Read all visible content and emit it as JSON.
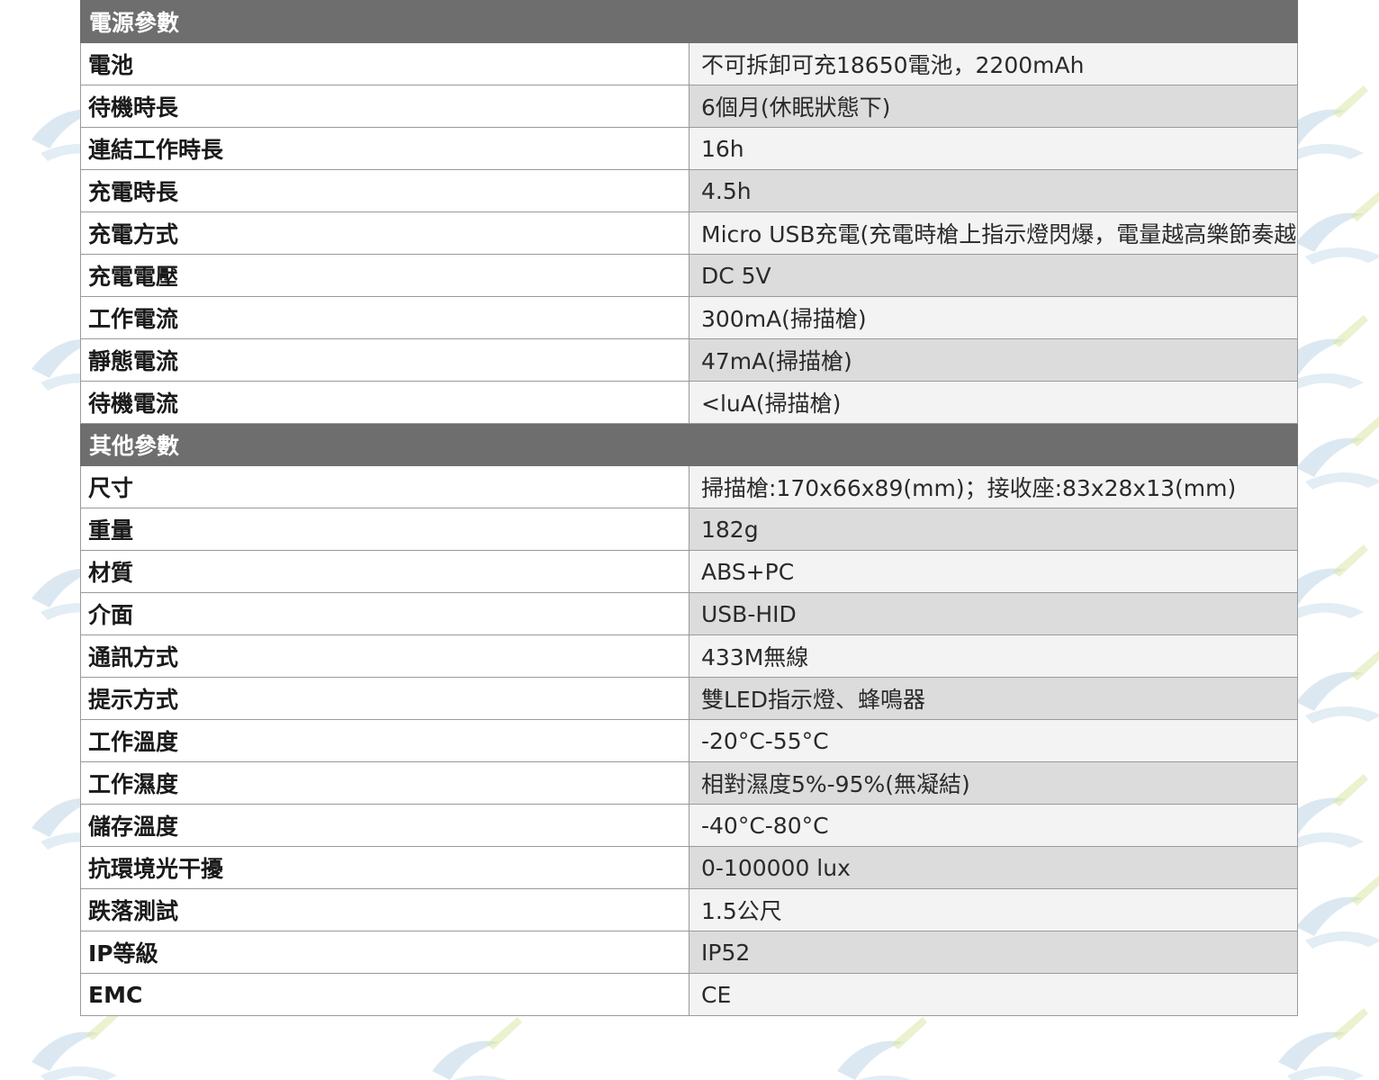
{
  "colors": {
    "header_bg": "#6e6e6e",
    "row_light": "#f3f3f3",
    "row_dark": "#dcdcdc",
    "watermark": "#cfe0ea"
  },
  "sections": [
    {
      "title": "電源參數",
      "rows": [
        {
          "label": "電池",
          "value": "不可拆卸可充18650電池，2200mAh"
        },
        {
          "label": "待機時長",
          "value": "6個月(休眠狀態下)"
        },
        {
          "label": "連結工作時長",
          "value": "16h"
        },
        {
          "label": "充電時長",
          "value": "4.5h"
        },
        {
          "label": "充電方式",
          "value": "Micro USB充電(充電時槍上指示燈閃爆，電量越高樂節奏越慢)"
        },
        {
          "label": "充電電壓",
          "value": "DC 5V"
        },
        {
          "label": "工作電流",
          "value": "300mA(掃描槍)"
        },
        {
          "label": "靜態電流",
          "value": "47mA(掃描槍)"
        },
        {
          "label": "待機電流",
          "value": "<luA(掃描槍)"
        }
      ]
    },
    {
      "title": "其他參數",
      "rows": [
        {
          "label": "尺寸",
          "value": "掃描槍:170x66x89(mm)；接收座:83x28x13(mm)"
        },
        {
          "label": "重量",
          "value": "182g"
        },
        {
          "label": "材質",
          "value": "ABS+PC"
        },
        {
          "label": "介面",
          "value": "USB-HID"
        },
        {
          "label": "通訊方式",
          "value": "433M無線"
        },
        {
          "label": "提示方式",
          "value": "雙LED指示燈、蜂鳴器"
        },
        {
          "label": "工作溫度",
          "value": "-20°C-55°C"
        },
        {
          "label": "工作濕度",
          "value": "相對濕度5%-95%(無凝結)"
        },
        {
          "label": "儲存溫度",
          "value": "-40°C-80°C"
        },
        {
          "label": "抗環境光干擾",
          "value": "0-100000 lux"
        },
        {
          "label": "跌落測試",
          "value": "1.5公尺"
        },
        {
          "label": "IP等級",
          "value": "IP52"
        },
        {
          "label": "EMC",
          "value": "CE"
        }
      ]
    }
  ]
}
